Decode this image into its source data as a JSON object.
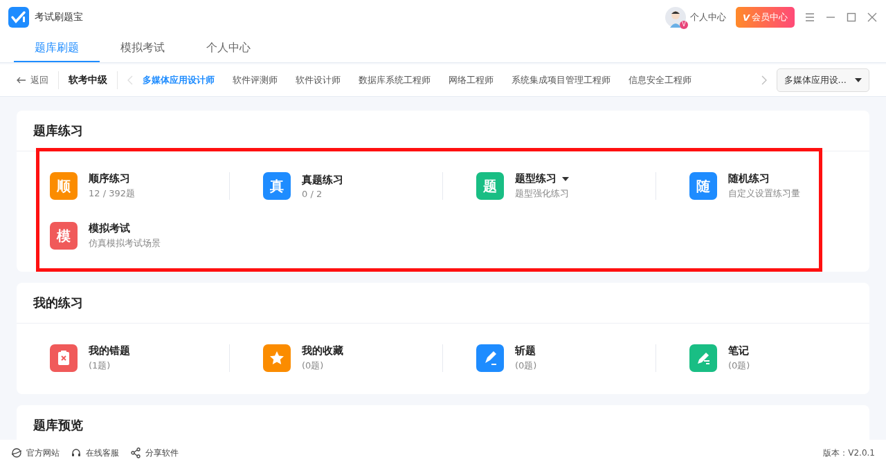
{
  "app": {
    "title": "考试刷题宝",
    "user": "个人中心",
    "avatar_badge": "V",
    "vip": "会员中心",
    "vip_mark": "V"
  },
  "tabs": [
    {
      "label": "题库刷题",
      "selected": true
    },
    {
      "label": "模拟考试",
      "selected": false
    },
    {
      "label": "个人中心",
      "selected": false
    }
  ],
  "category_bar": {
    "back": "返回",
    "level": "软考中级",
    "items": [
      {
        "label": "多媒体应用设计师",
        "selected": true
      },
      {
        "label": "软件评测师",
        "selected": false
      },
      {
        "label": "软件设计师",
        "selected": false
      },
      {
        "label": "数据库系统工程师",
        "selected": false
      },
      {
        "label": "网络工程师",
        "selected": false
      },
      {
        "label": "系统集成项目管理工程师",
        "selected": false
      },
      {
        "label": "信息安全工程师",
        "selected": false
      }
    ],
    "dropdown": "多媒体应用设..."
  },
  "sections": [
    {
      "title": "题库练习",
      "highlighted": true,
      "items": [
        {
          "kind": "letter",
          "glyph": "顺",
          "color": "#fb8c00",
          "title": "顺序练习",
          "sub": "12 / 392题",
          "has_menu": false
        },
        {
          "kind": "letter",
          "glyph": "真",
          "color": "#1e8cff",
          "title": "真题练习",
          "sub": "0 / 2",
          "has_menu": false
        },
        {
          "kind": "letter",
          "glyph": "题",
          "color": "#19be84",
          "title": "题型练习",
          "sub": "题型强化练习",
          "has_menu": true
        },
        {
          "kind": "letter",
          "glyph": "随",
          "color": "#1e8cff",
          "title": "随机练习",
          "sub": "自定义设置练习量",
          "has_menu": false
        },
        {
          "kind": "letter",
          "glyph": "模",
          "color": "#f05a5a",
          "title": "模拟考试",
          "sub": "仿真模拟考试场景",
          "has_menu": false
        }
      ]
    },
    {
      "title": "我的练习",
      "highlighted": false,
      "items": [
        {
          "kind": "wrong",
          "color": "#f05a5a",
          "title": "我的错题",
          "sub": "(1题)",
          "has_menu": false
        },
        {
          "kind": "star",
          "color": "#fb8c00",
          "title": "我的收藏",
          "sub": "(0题)",
          "has_menu": false
        },
        {
          "kind": "pen",
          "color": "#1e8cff",
          "title": "斩题",
          "sub": "(0题)",
          "has_menu": false
        },
        {
          "kind": "note",
          "color": "#19be84",
          "title": "笔记",
          "sub": "(0题)",
          "has_menu": false
        }
      ]
    },
    {
      "title": "题库预览"
    }
  ],
  "footer": {
    "links": [
      {
        "kind": "web",
        "label": "官方网站"
      },
      {
        "kind": "service",
        "label": "在线客服"
      },
      {
        "kind": "share",
        "label": "分享软件"
      }
    ],
    "version": "版本：V2.0.1"
  }
}
